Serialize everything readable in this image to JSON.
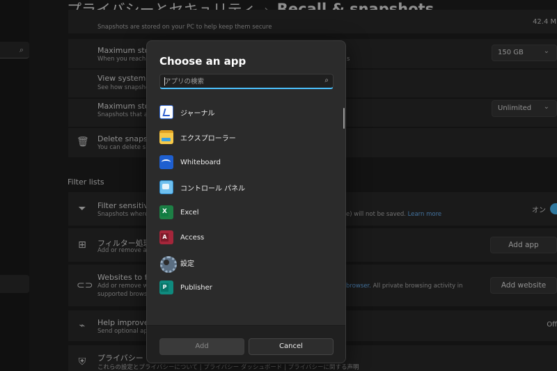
{
  "page": {
    "title_part1": "プライバシーとセキュリティ",
    "title_sep": "›",
    "title_part2": "Recall & snapshots"
  },
  "background": {
    "top_card": {
      "subtitle": "Snapshots are stored on your PC to help keep them secure",
      "right_value": "42.4 MB"
    },
    "max_storage": {
      "title": "Maximum stora",
      "subtitle_left": "When you reach t",
      "subtitle_right": "s",
      "value": "150 GB"
    },
    "view_system": {
      "title": "View system sto",
      "subtitle": "See how snapshot"
    },
    "max_storage2": {
      "title": "Maximum stora",
      "subtitle": "Snapshots that are",
      "value": "Unlimited"
    },
    "delete": {
      "title": "Delete snapsho",
      "subtitle": "You can delete sna"
    },
    "filter_lists_label": "Filter lists",
    "filter_sensitive": {
      "title": "Filter sensitive ir",
      "subtitle_left": "Snapshots where p",
      "subtitle_right": "e) will not be saved.",
      "link": "Learn more",
      "toggle_label": "オン"
    },
    "filter_apps": {
      "title": "フィルター処理する",
      "subtitle": "Add or remove ap",
      "button": "Add app"
    },
    "filter_websites": {
      "title": "Websites to filte",
      "subtitle_left": "Add or remove we",
      "subtitle_left2": "supported browse",
      "link": "browser.",
      "subtitle_right": "All private browsing activity in",
      "button": "Add website"
    },
    "help_improve": {
      "title": "Help improve R",
      "subtitle": "Send optional ap",
      "value": "Off"
    },
    "privacy": {
      "title": "プライバシー リソー",
      "links": "これらの設定とプライバシーについて | プライバシー ダッシュボード | プライバシーに関する声明"
    }
  },
  "dialog": {
    "title": "Choose an app",
    "search_placeholder": "アプリの検索",
    "apps": [
      {
        "label": "ジャーナル",
        "icon": "journal-icon"
      },
      {
        "label": "エクスプローラー",
        "icon": "file-explorer-icon"
      },
      {
        "label": "Whiteboard",
        "icon": "whiteboard-icon"
      },
      {
        "label": "コントロール パネル",
        "icon": "control-panel-icon"
      },
      {
        "label": "Excel",
        "icon": "excel-icon"
      },
      {
        "label": "Access",
        "icon": "access-icon"
      },
      {
        "label": "設定",
        "icon": "settings-icon"
      },
      {
        "label": "Publisher",
        "icon": "publisher-icon"
      }
    ],
    "add_label": "Add",
    "cancel_label": "Cancel"
  },
  "colors": {
    "accent": "#4cc2ff",
    "dialog_bg": "#2b2b2b",
    "page_bg": "#1f1f1f"
  }
}
